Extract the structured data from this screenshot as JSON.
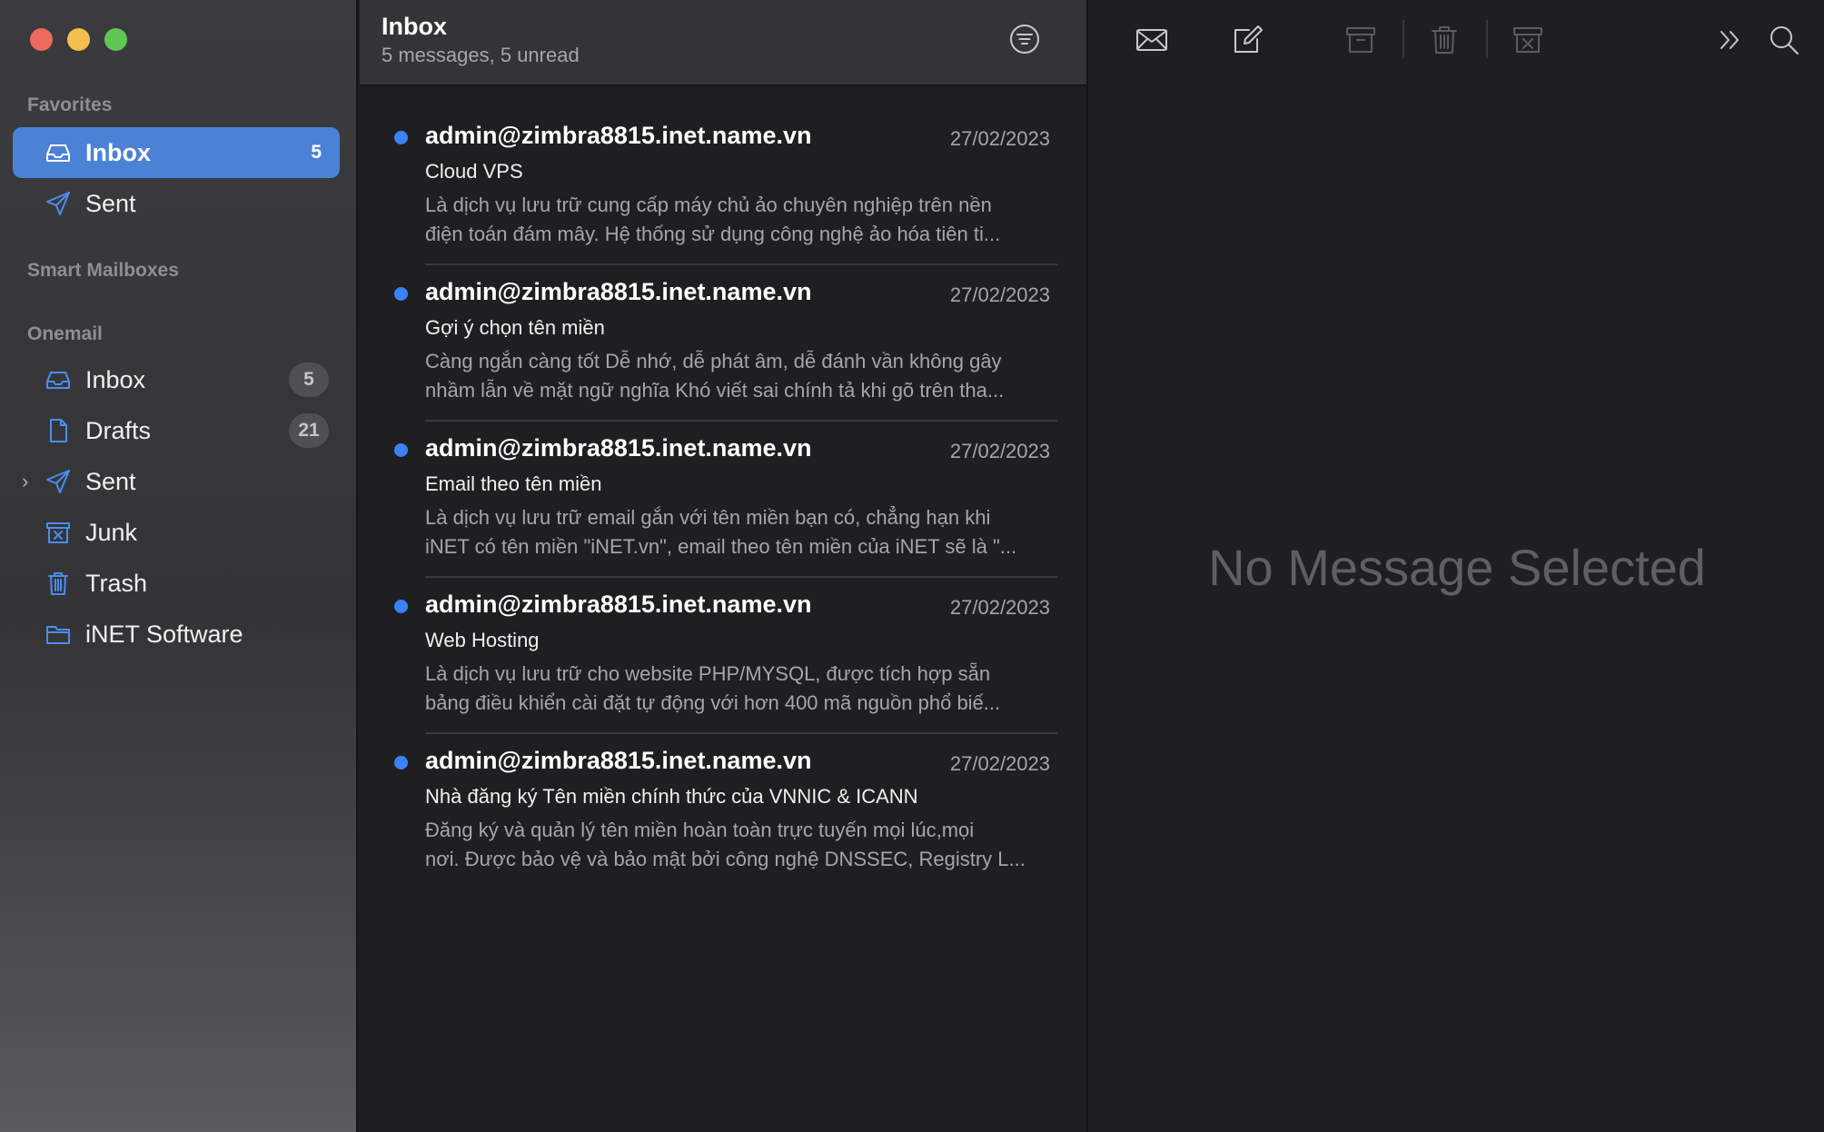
{
  "sidebar": {
    "favorites_label": "Favorites",
    "smart_mailboxes_label": "Smart Mailboxes",
    "account_label": "Onemail",
    "favorites": [
      {
        "label": "Inbox",
        "count": "5",
        "icon": "inbox-tray-icon"
      },
      {
        "label": "Sent",
        "icon": "paper-plane-icon"
      }
    ],
    "account_items": [
      {
        "label": "Inbox",
        "count": "5",
        "icon": "inbox-tray-icon"
      },
      {
        "label": "Drafts",
        "count": "21",
        "icon": "document-icon"
      },
      {
        "label": "Sent",
        "icon": "paper-plane-icon"
      },
      {
        "label": "Junk",
        "icon": "junk-bin-icon"
      },
      {
        "label": "Trash",
        "icon": "trash-icon"
      },
      {
        "label": "iNET Software",
        "icon": "folder-icon"
      }
    ]
  },
  "list": {
    "title": "Inbox",
    "subtitle": "5 messages, 5 unread",
    "messages": [
      {
        "from": "admin@zimbra8815.inet.name.vn",
        "date": "27/02/2023",
        "subject": "Cloud VPS",
        "preview_line1": "Là dịch vụ lưu trữ cung cấp máy chủ ảo chuyên nghiệp trên nền",
        "preview_line2": "điện toán đám mây. Hệ thống sử dụng công nghệ ảo hóa tiên ti...",
        "unread": true
      },
      {
        "from": "admin@zimbra8815.inet.name.vn",
        "date": "27/02/2023",
        "subject": "Gợi ý chọn tên miền",
        "preview_line1": "Càng ngắn càng tốt Dễ nhớ, dễ phát âm, dễ đánh vần không gây",
        "preview_line2": "nhầm lẫn về mặt ngữ nghĩa Khó viết sai chính tả khi gõ trên tha...",
        "unread": true
      },
      {
        "from": "admin@zimbra8815.inet.name.vn",
        "date": "27/02/2023",
        "subject": "Email theo tên miền",
        "preview_line1": "Là dịch vụ lưu trữ email gắn với tên miền bạn có, chẳng hạn khi",
        "preview_line2": "iNET có tên miền \"iNET.vn\", email theo tên miền của iNET sẽ là \"...",
        "unread": true
      },
      {
        "from": "admin@zimbra8815.inet.name.vn",
        "date": "27/02/2023",
        "subject": "Web Hosting",
        "preview_line1": "Là dịch vụ lưu trữ cho website PHP/MYSQL, được tích hợp sẵn",
        "preview_line2": "bảng điều khiển cài đặt tự động với hơn 400 mã nguồn phổ biế...",
        "unread": true
      },
      {
        "from": "admin@zimbra8815.inet.name.vn",
        "date": "27/02/2023",
        "subject": "Nhà đăng ký Tên miền chính thức của VNNIC & ICANN",
        "preview_line1": "Đăng ký và quản lý tên miền hoàn toàn trực tuyến mọi lúc,mọi",
        "preview_line2": "nơi. Được bảo vệ và bảo mật bởi công nghệ DNSSEC, Registry L...",
        "unread": true
      }
    ]
  },
  "reader": {
    "empty_text": "No Message Selected"
  },
  "colors": {
    "accent": "#4b82d6",
    "unread_dot": "#3b82f6",
    "icon_blue": "#4a8ef0"
  }
}
